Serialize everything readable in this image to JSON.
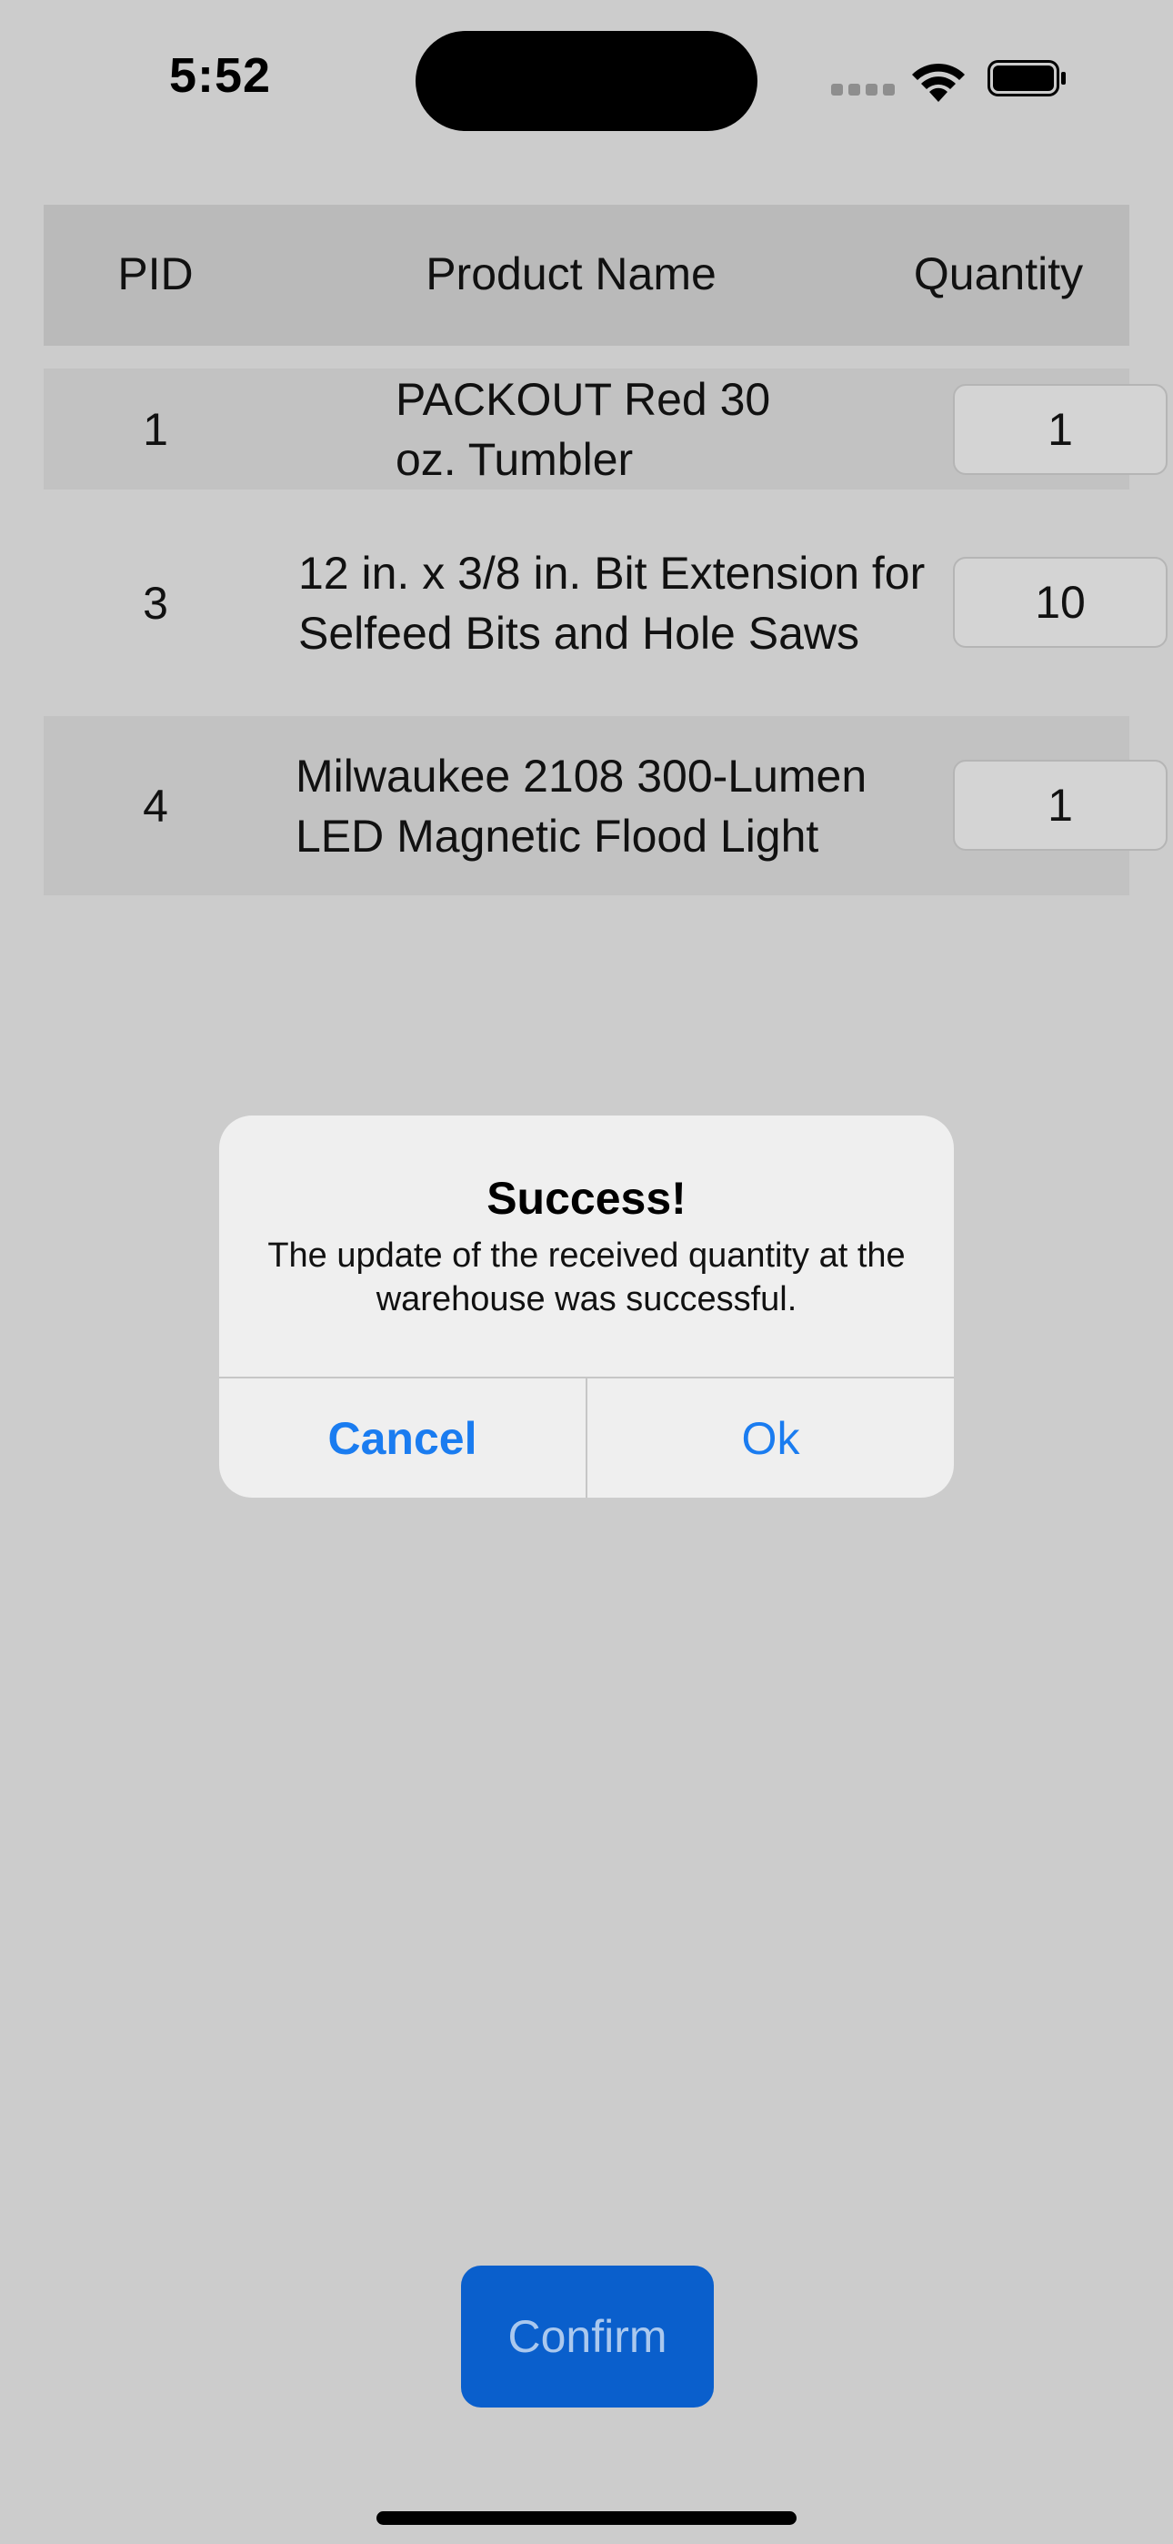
{
  "status_bar": {
    "time": "5:52"
  },
  "table": {
    "headers": {
      "pid": "PID",
      "product_name": "Product Name",
      "quantity": "Quantity"
    },
    "rows": [
      {
        "pid": "1",
        "name": "PACKOUT Red 30 oz. Tumbler",
        "quantity": "1"
      },
      {
        "pid": "3",
        "name": "12 in. x 3/8 in. Bit Extension for Selfeed Bits and Hole Saws",
        "quantity": "10"
      },
      {
        "pid": "4",
        "name": "Milwaukee 2108 300-Lumen LED Magnetic Flood Light",
        "quantity": "1"
      }
    ]
  },
  "alert": {
    "title": "Success!",
    "message": "The update of the received quantity at the warehouse was successful.",
    "cancel_label": "Cancel",
    "ok_label": "Ok"
  },
  "confirm_label": "Confirm",
  "colors": {
    "background": "#cccccc",
    "accent": "#1a7cf0",
    "confirm_button": "#0a5fcc"
  }
}
